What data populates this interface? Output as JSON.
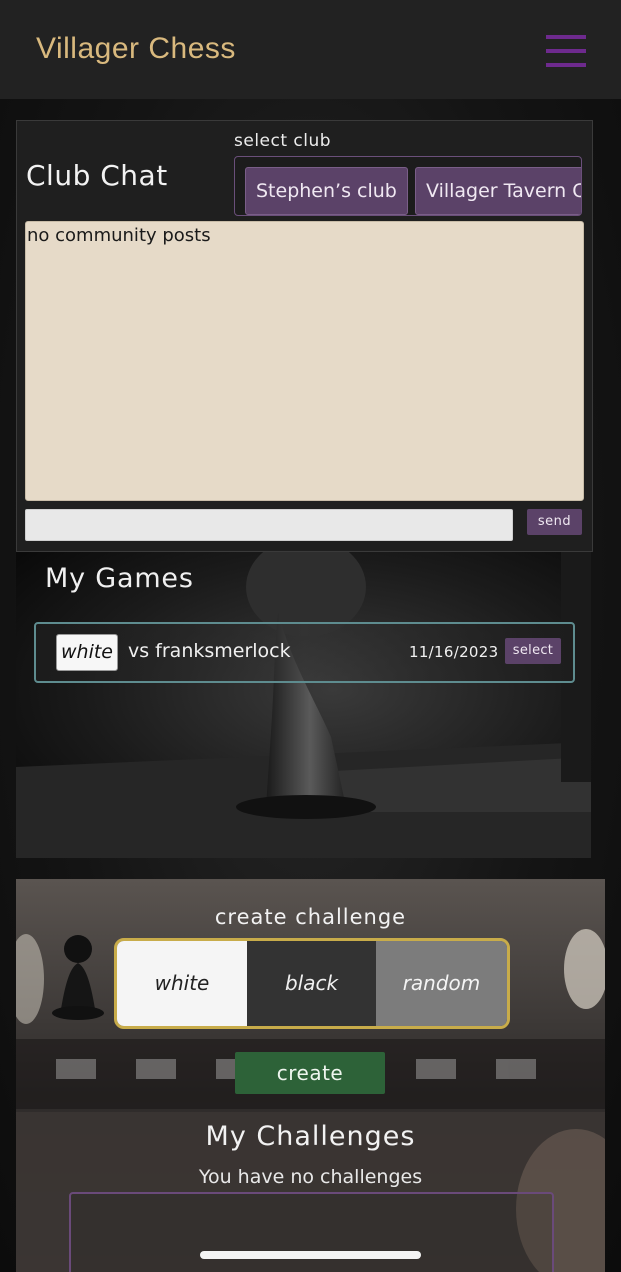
{
  "app": {
    "title": "Villager Chess"
  },
  "club_chat": {
    "title": "Club Chat",
    "select_label": "select club",
    "clubs": [
      "Stephen’s club",
      "Villager Tavern Cl"
    ],
    "posts_text": "no community posts",
    "input_value": "",
    "send_label": "send"
  },
  "my_games": {
    "title": "My Games",
    "games": [
      {
        "color": "white",
        "opponent": "vs franksmerlock",
        "date": "11/16/2023",
        "select_label": "select"
      }
    ]
  },
  "create_challenge": {
    "title": "create challenge",
    "options": [
      "white",
      "black",
      "random"
    ],
    "create_label": "create"
  },
  "my_challenges": {
    "title": "My Challenges",
    "empty_text": "You have no challenges"
  },
  "colors": {
    "accent_purple": "#5b4268",
    "title_gold": "#d9b97e",
    "create_green": "#2d6238",
    "choice_border_gold": "#c8ac4a"
  }
}
